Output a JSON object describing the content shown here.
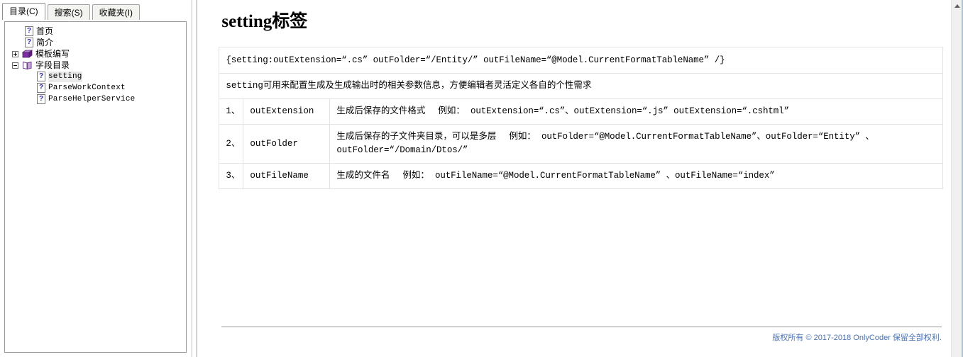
{
  "left_panel": {
    "tabs": [
      {
        "label": "目录(C)",
        "active": true,
        "name": "tab-contents"
      },
      {
        "label": "搜索(S)",
        "active": false,
        "name": "tab-search"
      },
      {
        "label": "收藏夹(I)",
        "active": false,
        "name": "tab-favorites"
      }
    ],
    "tree": [
      {
        "label": "首页",
        "icon": "page-question-icon",
        "level": 1,
        "expander": "none",
        "selected": false,
        "mono": false
      },
      {
        "label": "简介",
        "icon": "page-question-icon",
        "level": 1,
        "expander": "none",
        "selected": false,
        "mono": false
      },
      {
        "label": "模板编写",
        "icon": "book-purple-icon",
        "level": 0,
        "expander": "plus",
        "selected": false,
        "mono": false
      },
      {
        "label": "字段目录",
        "icon": "book-open-icon",
        "level": 0,
        "expander": "minus",
        "selected": false,
        "mono": false
      },
      {
        "label": "setting",
        "icon": "page-question-icon",
        "level": 2,
        "expander": "none",
        "selected": true,
        "mono": true
      },
      {
        "label": "ParseWorkContext",
        "icon": "page-question-icon",
        "level": 2,
        "expander": "none",
        "selected": false,
        "mono": true
      },
      {
        "label": "ParseHelperService",
        "icon": "page-question-icon",
        "level": 2,
        "expander": "none",
        "selected": false,
        "mono": true
      }
    ]
  },
  "content": {
    "title": "setting标签",
    "syntax_row": "{setting:outExtension=“.cs” outFolder=“/Entity/” outFileName=“@Model.CurrentFormatTableName” /}",
    "description_row": "setting可用来配置生成及生成输出时的相关参数信息，方便编辑者灵活定义各自的个性需求",
    "params": [
      {
        "index": "1、",
        "name": "outExtension",
        "desc": "生成后保存的文件格式",
        "example_label": "例如：",
        "example": "outExtension=“.cs”、outExtension=“.js” outExtension=“.cshtml”"
      },
      {
        "index": "2、",
        "name": "outFolder",
        "desc": "生成后保存的子文件夹目录，可以是多层",
        "example_label": "例如：",
        "example": "outFolder=“@Model.CurrentFormatTableName”、outFolder=“Entity” 、outFolder=“/Domain/Dtos/”"
      },
      {
        "index": "3、",
        "name": "outFileName",
        "desc": "生成的文件名",
        "example_label": "例如：",
        "example": "outFileName=“@Model.CurrentFormatTableName” 、outFileName=“index”"
      }
    ],
    "footer": "版权所有 © 2017-2018 OnlyCoder 保留全部权利.",
    "footer_color": "#4a72b8"
  },
  "scrollbar": {
    "up_arrow": "scroll-up-arrow-icon"
  }
}
